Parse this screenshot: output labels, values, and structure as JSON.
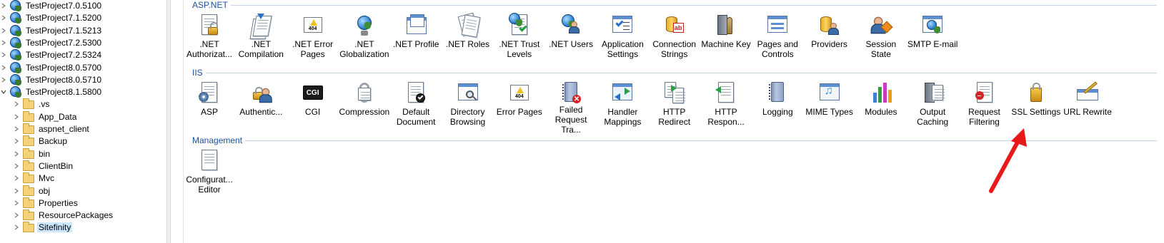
{
  "tree": {
    "items": [
      {
        "label": "TestProject7.0.5100",
        "type": "site",
        "expanded": false
      },
      {
        "label": "TestProject7.1.5200",
        "type": "site",
        "expanded": false
      },
      {
        "label": "TestProject7.1.5213",
        "type": "site",
        "expanded": false
      },
      {
        "label": "TestProject7.2.5300",
        "type": "site",
        "expanded": false
      },
      {
        "label": "TestProject7.2.5324",
        "type": "site",
        "expanded": false
      },
      {
        "label": "TestProject8.0.5700",
        "type": "site",
        "expanded": false
      },
      {
        "label": "TestProject8.0.5710",
        "type": "site",
        "expanded": false
      },
      {
        "label": "TestProject8.1.5800",
        "type": "site",
        "expanded": true
      },
      {
        "label": ".vs",
        "type": "folder",
        "expanded": false
      },
      {
        "label": "App_Data",
        "type": "folder",
        "expanded": false
      },
      {
        "label": "aspnet_client",
        "type": "folder",
        "expanded": false
      },
      {
        "label": "Backup",
        "type": "folder",
        "expanded": false
      },
      {
        "label": "bin",
        "type": "folder",
        "expanded": false
      },
      {
        "label": "ClientBin",
        "type": "folder",
        "expanded": false
      },
      {
        "label": "Mvc",
        "type": "folder",
        "expanded": false
      },
      {
        "label": "obj",
        "type": "folder",
        "expanded": false
      },
      {
        "label": "Properties",
        "type": "folder",
        "expanded": false
      },
      {
        "label": "ResourcePackages",
        "type": "folder",
        "expanded": false
      },
      {
        "label": "Sitefinity",
        "type": "folder",
        "expanded": false,
        "selected": true
      }
    ]
  },
  "groups": {
    "aspnet": {
      "title": "ASP.NET",
      "features": [
        {
          "label": ".NET\nAuthorizat...",
          "icon": "net-authorization-icon"
        },
        {
          "label": ".NET\nCompilation",
          "icon": "net-compilation-icon"
        },
        {
          "label": ".NET Error\nPages",
          "icon": "net-error-pages-icon"
        },
        {
          "label": ".NET\nGlobalization",
          "icon": "net-globalization-icon"
        },
        {
          "label": ".NET Profile",
          "icon": "net-profile-icon"
        },
        {
          "label": ".NET Roles",
          "icon": "net-roles-icon"
        },
        {
          "label": ".NET Trust\nLevels",
          "icon": "net-trust-levels-icon"
        },
        {
          "label": ".NET Users",
          "icon": "net-users-icon"
        },
        {
          "label": "Application\nSettings",
          "icon": "application-settings-icon"
        },
        {
          "label": "Connection\nStrings",
          "icon": "connection-strings-icon"
        },
        {
          "label": "Machine Key",
          "icon": "machine-key-icon"
        },
        {
          "label": "Pages and\nControls",
          "icon": "pages-and-controls-icon"
        },
        {
          "label": "Providers",
          "icon": "providers-icon"
        },
        {
          "label": "Session State",
          "icon": "session-state-icon"
        },
        {
          "label": "SMTP E-mail",
          "icon": "smtp-email-icon"
        }
      ]
    },
    "iis": {
      "title": "IIS",
      "features": [
        {
          "label": "ASP",
          "icon": "asp-icon"
        },
        {
          "label": "Authentic...",
          "icon": "authentication-icon"
        },
        {
          "label": "CGI",
          "icon": "cgi-icon"
        },
        {
          "label": "Compression",
          "icon": "compression-icon"
        },
        {
          "label": "Default\nDocument",
          "icon": "default-document-icon"
        },
        {
          "label": "Directory\nBrowsing",
          "icon": "directory-browsing-icon"
        },
        {
          "label": "Error Pages",
          "icon": "error-pages-icon"
        },
        {
          "label": "Failed\nRequest Tra...",
          "icon": "failed-request-tracing-icon"
        },
        {
          "label": "Handler\nMappings",
          "icon": "handler-mappings-icon"
        },
        {
          "label": "HTTP\nRedirect",
          "icon": "http-redirect-icon"
        },
        {
          "label": "HTTP\nRespon...",
          "icon": "http-response-headers-icon"
        },
        {
          "label": "Logging",
          "icon": "logging-icon"
        },
        {
          "label": "MIME Types",
          "icon": "mime-types-icon"
        },
        {
          "label": "Modules",
          "icon": "modules-icon"
        },
        {
          "label": "Output\nCaching",
          "icon": "output-caching-icon"
        },
        {
          "label": "Request\nFiltering",
          "icon": "request-filtering-icon"
        },
        {
          "label": "SSL Settings",
          "icon": "ssl-settings-icon"
        },
        {
          "label": "URL Rewrite",
          "icon": "url-rewrite-icon"
        }
      ]
    },
    "management": {
      "title": "Management",
      "features": [
        {
          "label": "Configurat...\nEditor",
          "icon": "configuration-editor-icon"
        }
      ]
    }
  },
  "colors": {
    "group_header_text": "#1e50a0",
    "selection": "#cce8ff",
    "callout_arrow": "#e8191b"
  },
  "glyphs": {
    "error_code": "404",
    "cgi_text": "CGI",
    "failed_mark": "✕"
  }
}
